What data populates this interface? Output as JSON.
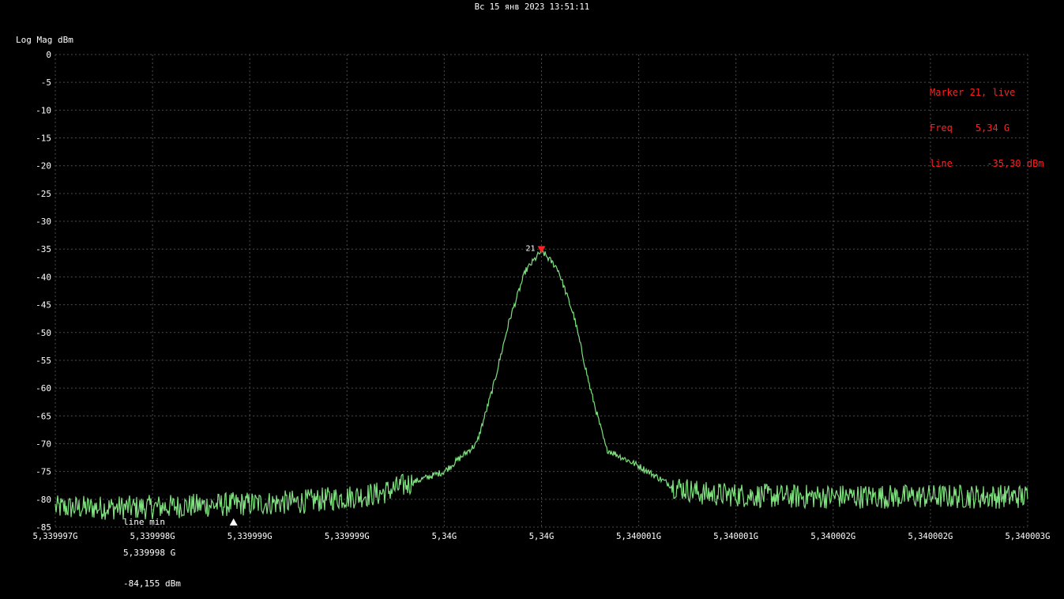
{
  "header": {
    "timestamp": "Вс 15 янв 2023 13:51:11"
  },
  "marker": {
    "title": "Marker 21, live",
    "freq_label": "Freq",
    "freq_value": "5,34 G",
    "line_label": "line",
    "line_value": "-35,30 dBm",
    "id_label": "21",
    "freq_hz": 5340000000,
    "level_dbm": -35.3
  },
  "min_marker": {
    "title": "line min",
    "freq": "5,339998 G",
    "value": "-84,155 dBm",
    "freq_hz": 5339998100,
    "level_dbm": -84.155
  },
  "colors": {
    "background": "#000000",
    "trace": "#7ee07e",
    "grid": "#4a4a4a",
    "marker": "#ff2020",
    "text": "#ffffff"
  },
  "chart_data": {
    "type": "line",
    "ylabel": "Log Mag dBm",
    "xlabel": "",
    "ylim": [
      -85,
      0
    ],
    "xlim": [
      5339997000,
      5340003000
    ],
    "y_ticks": [
      0,
      -5,
      -10,
      -15,
      -20,
      -25,
      -30,
      -35,
      -40,
      -45,
      -50,
      -55,
      -60,
      -65,
      -70,
      -75,
      -80,
      -85
    ],
    "x_tick_labels": [
      "5,339997G",
      "5,339998G",
      "5,339999G",
      "5,339999G",
      "5,34G",
      "5,34G",
      "5,340001G",
      "5,340001G",
      "5,340002G",
      "5,340002G",
      "5,340003G"
    ],
    "grid": true,
    "series": [
      {
        "x": [
          5339997000,
          5339997500,
          5339998000,
          5339998500,
          5339999000,
          5339999200,
          5339999400,
          5339999600,
          5339999700,
          5339999800,
          5339999900,
          5340000000,
          5340000100,
          5340000200,
          5340000300,
          5340000400,
          5340000600,
          5340000800,
          5340001000,
          5340001500,
          5340002000,
          5340002500,
          5340003000
        ],
        "y": [
          -81.5,
          -81.5,
          -81,
          -80.5,
          -79,
          -77,
          -75,
          -70,
          -60,
          -48,
          -39,
          -35.3,
          -38.5,
          -47,
          -60,
          -71,
          -74,
          -77.5,
          -79,
          -79.5,
          -79.5,
          -79.5,
          -79.5
        ]
      }
    ]
  }
}
